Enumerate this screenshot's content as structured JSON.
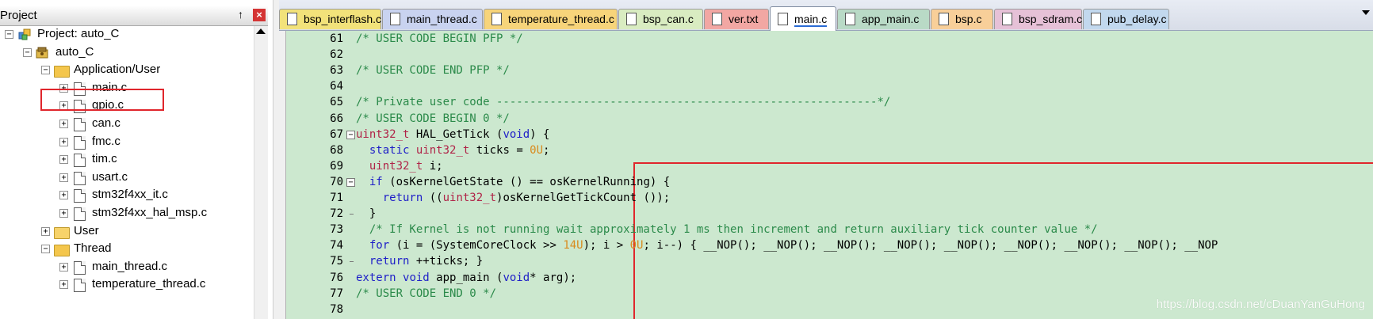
{
  "project_panel": {
    "title": "Project",
    "pin_glyph": "↑",
    "close_glyph": "×",
    "tree": [
      {
        "label": "Project: auto_C",
        "toggle": "−",
        "icon": "project-icon"
      },
      {
        "label": "auto_C",
        "toggle": "−",
        "icon": "target-icon"
      },
      {
        "label": "Application/User",
        "toggle": "−",
        "icon": "folder-open-icon"
      },
      {
        "label": "main.c",
        "toggle": "+",
        "icon": "file-icon"
      },
      {
        "label": "gpio.c",
        "toggle": "+",
        "icon": "file-icon"
      },
      {
        "label": "can.c",
        "toggle": "+",
        "icon": "file-icon"
      },
      {
        "label": "fmc.c",
        "toggle": "+",
        "icon": "file-icon"
      },
      {
        "label": "tim.c",
        "toggle": "+",
        "icon": "file-icon"
      },
      {
        "label": "usart.c",
        "toggle": "+",
        "icon": "file-icon"
      },
      {
        "label": "stm32f4xx_it.c",
        "toggle": "+",
        "icon": "file-icon"
      },
      {
        "label": "stm32f4xx_hal_msp.c",
        "toggle": "+",
        "icon": "file-icon"
      },
      {
        "label": "User",
        "toggle": "+",
        "icon": "folder-icon"
      },
      {
        "label": "Thread",
        "toggle": "−",
        "icon": "folder-open-icon"
      },
      {
        "label": "main_thread.c",
        "toggle": "+",
        "icon": "file-icon"
      },
      {
        "label": "temperature_thread.c",
        "toggle": "+",
        "icon": "file-icon"
      }
    ]
  },
  "tabs": [
    {
      "label": "bsp_interflash.c",
      "color": "#f2e27a"
    },
    {
      "label": "main_thread.c",
      "color": "#c9d3f0"
    },
    {
      "label": "temperature_thread.c",
      "color": "#f7d47a"
    },
    {
      "label": "bsp_can.c",
      "color": "#d9ecc1"
    },
    {
      "label": "ver.txt",
      "color": "#f2a7a3"
    },
    {
      "label": "main.c",
      "color": "#c6b7e6"
    },
    {
      "label": "app_main.c",
      "color": "#b9dac6"
    },
    {
      "label": "bsp.c",
      "color": "#f8cf99"
    },
    {
      "label": "bsp_sdram.c",
      "color": "#e6c1d7"
    },
    {
      "label": "pub_delay.c",
      "color": "#c2d8ee"
    }
  ],
  "active_tab": "main.c",
  "code_lines": [
    {
      "n": "61",
      "html": "<span class=\"cmt\">/* USER CODE BEGIN PFP */</span>"
    },
    {
      "n": "62",
      "html": ""
    },
    {
      "n": "63",
      "html": "<span class=\"cmt\">/* USER CODE END PFP */</span>"
    },
    {
      "n": "64",
      "html": ""
    },
    {
      "n": "65",
      "html": "<span class=\"cmt\">/* Private user code ---------------------------------------------------------*/</span>"
    },
    {
      "n": "66",
      "html": "<span class=\"cmt\">/* USER CODE BEGIN 0 */</span>"
    },
    {
      "n": "67",
      "html": "<span class=\"ty\">uint32_t</span> HAL_GetTick (<span class=\"kw\">void</span>) {"
    },
    {
      "n": "68",
      "html": "  <span class=\"kw\">static</span> <span class=\"ty\">uint32_t</span> ticks = <span class=\"num\">0U</span>;"
    },
    {
      "n": "69",
      "html": "  <span class=\"ty\">uint32_t</span> i;"
    },
    {
      "n": "70",
      "html": "  <span class=\"kw\">if</span> (osKernelGetState () == osKernelRunning) {"
    },
    {
      "n": "71",
      "html": "    <span class=\"kw\">return</span> ((<span class=\"ty\">uint32_t</span>)osKernelGetTickCount ());"
    },
    {
      "n": "72",
      "html": "  }"
    },
    {
      "n": "73",
      "html": "  <span class=\"cmt\">/* If Kernel is not running wait approximately 1 ms then increment and return auxiliary tick counter value */</span>"
    },
    {
      "n": "74",
      "html": "  <span class=\"kw\">for</span> (i = (SystemCoreClock &gt;&gt; <span class=\"num\">14U</span>); i &gt; <span class=\"num\">0U</span>; i--) { __NOP(); __NOP(); __NOP(); __NOP(); __NOP(); __NOP(); __NOP(); __NOP(); __NOP"
    },
    {
      "n": "75",
      "html": "  <span class=\"kw\">return</span> ++ticks; }"
    },
    {
      "n": "76",
      "html": "<span class=\"kw\">extern</span> <span class=\"kw\">void</span> app_main (<span class=\"kw\">void</span>* arg);"
    },
    {
      "n": "77",
      "html": "<span class=\"cmt\">/* USER CODE END 0 */</span>"
    },
    {
      "n": "78",
      "html": ""
    }
  ],
  "watermark": "https://blog.csdn.net/cDuanYanGuHong",
  "colors": {
    "highlight_box": "#e0262c",
    "editor_bg": "#cce8cf"
  }
}
